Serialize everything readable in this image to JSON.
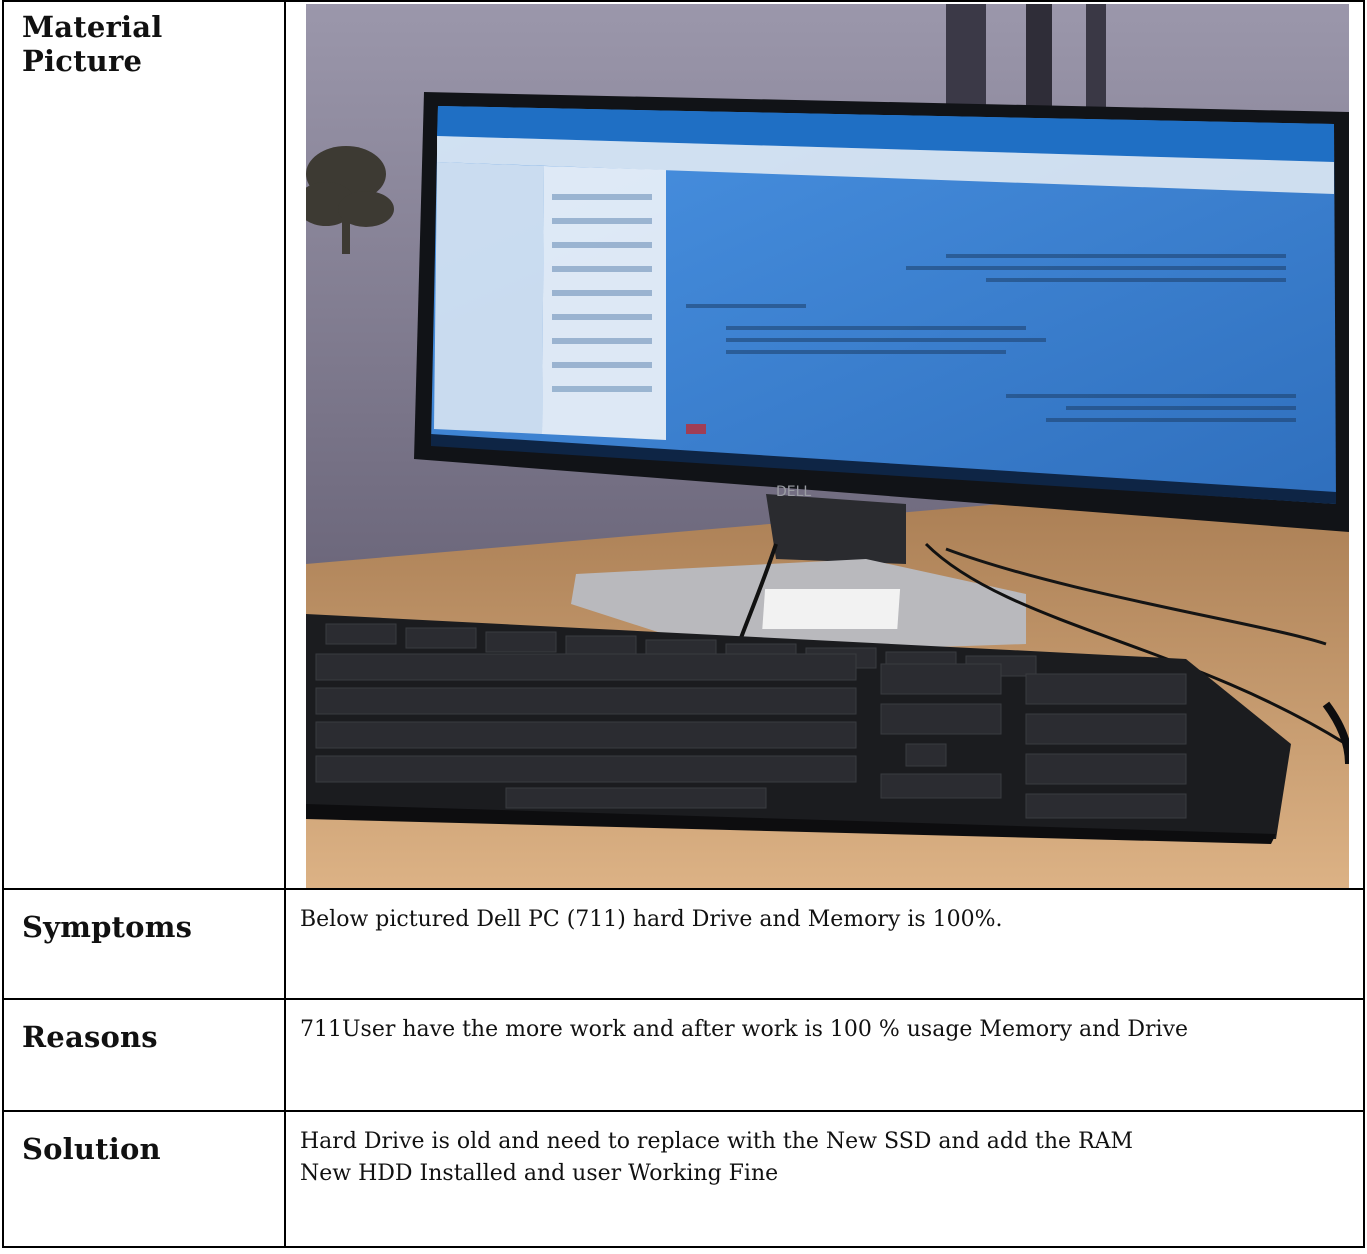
{
  "rows": [
    {
      "label": "Material Picture"
    },
    {
      "label": "Symptoms",
      "text": "Below pictured Dell PC (711) hard Drive and Memory is 100%."
    },
    {
      "label": "Reasons",
      "text": "711User have the more work and after work is 100 % usage Memory and Drive"
    },
    {
      "label": "Solution",
      "lines": [
        "Hard Drive is old and need to replace with the New SSD and add the RAM",
        "New HDD Installed and user Working Fine"
      ]
    }
  ],
  "photo": {
    "monitor_brand": "DELL",
    "colors": {
      "wall": "#7f7a90",
      "desk": "#c79a6c",
      "screen": "#3f86d6",
      "bezel": "#111317",
      "keyboard": "#1b1c1f"
    }
  }
}
